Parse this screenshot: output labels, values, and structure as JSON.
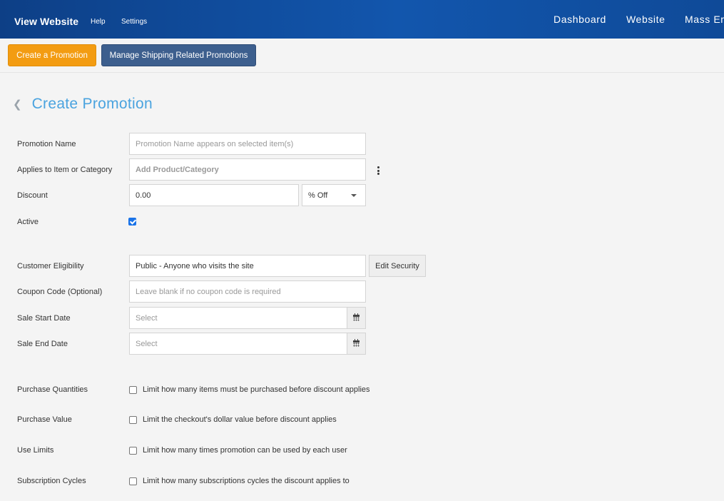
{
  "topbar": {
    "brand": "View Website",
    "help": "Help",
    "settings": "Settings",
    "nav": [
      "Dashboard",
      "Website",
      "Mass Em"
    ]
  },
  "actions": {
    "create_promotion": "Create a Promotion",
    "manage_shipping": "Manage Shipping Related Promotions"
  },
  "page": {
    "back_icon": "chevron-left-icon",
    "title": "Create Promotion"
  },
  "form": {
    "promotion_name": {
      "label": "Promotion Name",
      "placeholder": "Promotion Name appears on selected item(s)"
    },
    "applies_to": {
      "label": "Applies to Item or Category",
      "placeholder": "Add Product/Category",
      "menu_icon": "kebab-menu-icon"
    },
    "discount": {
      "label": "Discount",
      "value": "0.00",
      "type_selected": "% Off"
    },
    "active": {
      "label": "Active",
      "checked": true
    },
    "customer_eligibility": {
      "label": "Customer Eligibility",
      "value": "Public - Anyone who visits the site",
      "button": "Edit Security"
    },
    "coupon_code": {
      "label": "Coupon Code (Optional)",
      "placeholder": "Leave blank if no coupon code is required"
    },
    "sale_start": {
      "label": "Sale Start Date",
      "placeholder": "Select",
      "icon": "calendar-icon"
    },
    "sale_end": {
      "label": "Sale End Date",
      "placeholder": "Select",
      "icon": "calendar-icon"
    },
    "purchase_quantities": {
      "label": "Purchase Quantities",
      "option": "Limit how many items must be purchased before discount applies",
      "checked": false
    },
    "purchase_value": {
      "label": "Purchase Value",
      "option": "Limit the checkout's dollar value before discount applies",
      "checked": false
    },
    "use_limits": {
      "label": "Use Limits",
      "option": "Limit how many times promotion can be used by each user",
      "checked": false
    },
    "subscription_cycles": {
      "label": "Subscription Cycles",
      "option": "Limit how many subscriptions cycles the discount applies to",
      "checked": false
    }
  },
  "colors": {
    "header_blue": "#1256ad",
    "orange": "#f39c12",
    "navy": "#3d5f8e",
    "title_blue": "#4aa3df",
    "checkbox_blue": "#1a73e8"
  }
}
